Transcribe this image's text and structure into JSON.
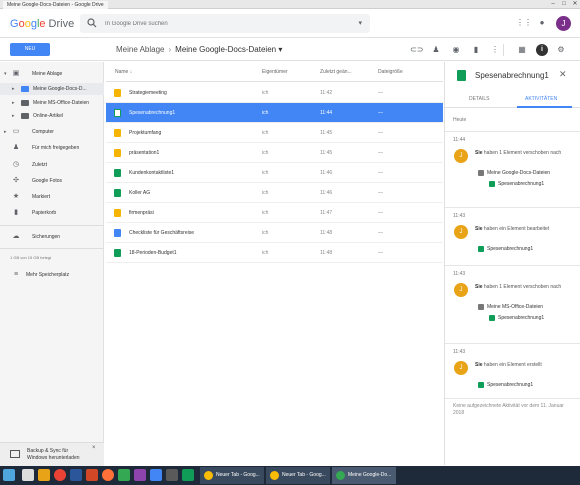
{
  "window": {
    "title": "Meine Google-Docs-Dateien - Google Drive"
  },
  "header": {
    "logo_google": "Google",
    "logo_drive": "Drive",
    "search_placeholder": "In Google Drive suchen",
    "avatar_letter": "J"
  },
  "toolbar": {
    "new_label": "NEU",
    "breadcrumb_root": "Meine Ablage",
    "breadcrumb_sep": "›",
    "breadcrumb_current": "Meine Google-Docs-Dateien ▾"
  },
  "sidebar": {
    "items": [
      {
        "label": "Meine Ablage"
      },
      {
        "label": "Meine Google-Docs-D..."
      },
      {
        "label": "Meine MS-Office-Dateien"
      },
      {
        "label": "Online-Artikel"
      },
      {
        "label": "Computer"
      },
      {
        "label": "Für mich freigegeben"
      },
      {
        "label": "Zuletzt"
      },
      {
        "label": "Google Fotos"
      },
      {
        "label": "Markiert"
      },
      {
        "label": "Papierkorb"
      },
      {
        "label": "Sicherungen"
      },
      {
        "label": "Mehr Speicherplatz"
      }
    ],
    "storage_text": "1 GB von 15 GB belegt",
    "backup_line1": "Backup & Sync für",
    "backup_line2": "Windows herunterladen"
  },
  "list": {
    "columns": [
      "Name ↓",
      "Eigentümer",
      "Zuletzt geän...",
      "Dateigröße"
    ],
    "rows": [
      {
        "name": "Strategiemeeting",
        "owner": "ich",
        "modified": "11:42",
        "size": "—",
        "type": "slides"
      },
      {
        "name": "Spesenabrechnung1",
        "owner": "ich",
        "modified": "11:44",
        "size": "—",
        "type": "sheets"
      },
      {
        "name": "Projektumfang",
        "owner": "ich",
        "modified": "11:45",
        "size": "—",
        "type": "slides"
      },
      {
        "name": "präsentation1",
        "owner": "ich",
        "modified": "11:45",
        "size": "—",
        "type": "slides"
      },
      {
        "name": "Kundenkontaktliste1",
        "owner": "ich",
        "modified": "11:46",
        "size": "—",
        "type": "sheets"
      },
      {
        "name": "Koller AG",
        "owner": "ich",
        "modified": "11:46",
        "size": "—",
        "type": "sheets"
      },
      {
        "name": "firmenpräsi",
        "owner": "ich",
        "modified": "11:47",
        "size": "—",
        "type": "slides"
      },
      {
        "name": "Checkliste für Geschäftsreise",
        "owner": "ich",
        "modified": "11:48",
        "size": "—",
        "type": "docs"
      },
      {
        "name": "18-Perioden-Budget1",
        "owner": "ich",
        "modified": "11:48",
        "size": "—",
        "type": "sheets"
      }
    ]
  },
  "details": {
    "title": "Spesenabrechnung1",
    "tab_details": "DETAILS",
    "tab_activity": "AKTIVITÄTEN",
    "today": "Heute",
    "activities": [
      {
        "time": "11:44",
        "who": "Sie",
        "text": "haben 1 Element verschoben nach",
        "folder": "Meine Google-Docs-Dateien",
        "file": "Spesenabrechnung1"
      },
      {
        "time": "11:43",
        "who": "Sie",
        "text": "haben ein Element bearbeitet",
        "folder": "",
        "file": "Spesenabrechnung1"
      },
      {
        "time": "11:43",
        "who": "Sie",
        "text": "haben 1 Element verschoben nach",
        "folder": "Meine MS-Office-Dateien",
        "file": "Spesenabrechnung1"
      },
      {
        "time": "11:43",
        "who": "Sie",
        "text": "haben ein Element erstellt",
        "folder": "",
        "file": "Spesenabrechnung1"
      }
    ],
    "footer": "Keine aufgezeichnete Aktivität vor dem 11. Januar 2018"
  },
  "taskbar": {
    "tasks": [
      "Neuer Tab - Goog...",
      "Neuer Tab - Goog...",
      "Meine Google-Do..."
    ]
  },
  "colors": {
    "accent": "#4285f4",
    "sheets": "#0f9d58",
    "slides": "#f4b400",
    "docs": "#4285f4",
    "activity_avatar": "#e8a317"
  }
}
